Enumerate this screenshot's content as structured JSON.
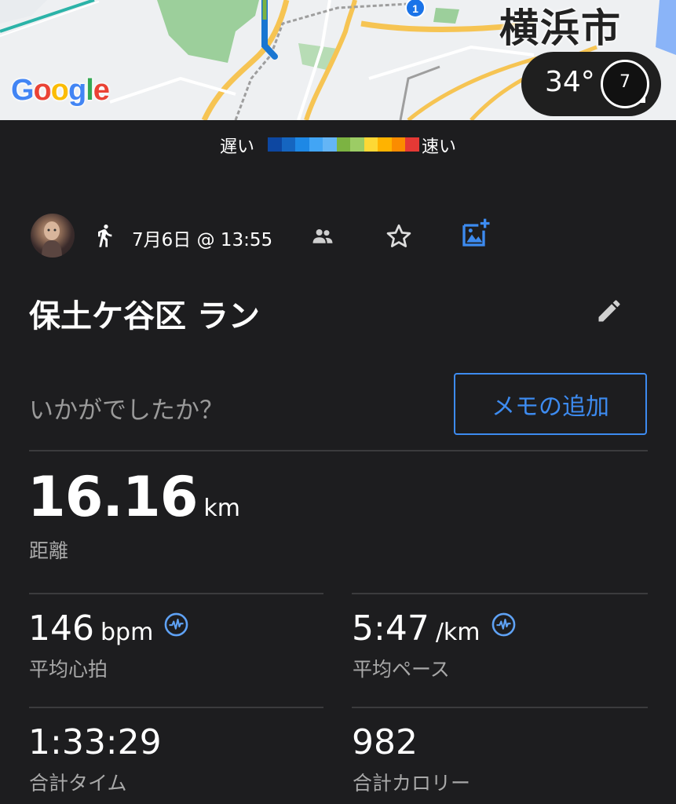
{
  "map": {
    "logo": "Google",
    "city_label": "横浜市",
    "route_badge": "1",
    "weather": {
      "temperature": "34°",
      "aqi": "7"
    },
    "colors": {
      "route": "#1976d2",
      "route_fast": "#7cb342"
    }
  },
  "legend": {
    "slow_label": "遅い",
    "fast_label": "速い",
    "colors": [
      "#0d47a1",
      "#1565c0",
      "#1e88e5",
      "#42a5f5",
      "#64b5f6",
      "#7cb342",
      "#9ccc65",
      "#fdd835",
      "#ffb300",
      "#fb8c00",
      "#e53935"
    ]
  },
  "activity": {
    "avatar": "avatar",
    "type_icon": "running-icon",
    "datetime": "7月6日 @ 13:55",
    "title": "保土ケ谷区 ラン",
    "prompt": "いかがでしたか？",
    "memo_button": "メモの追加"
  },
  "stats": {
    "distance": {
      "value": "16.16",
      "unit": "km",
      "label": "距離"
    },
    "avg_hr": {
      "value": "146",
      "unit": "bpm",
      "label": "平均心拍"
    },
    "avg_pace": {
      "value": "5:47",
      "unit": "/km",
      "label": "平均ペース"
    },
    "total_time": {
      "value": "1:33:29",
      "label": "合計タイム"
    },
    "calories": {
      "value": "982",
      "label": "合計カロリー"
    }
  },
  "theme": {
    "accent": "#3d8bf0",
    "background": "#1d1d1f",
    "divider": "#3b3b3d"
  }
}
